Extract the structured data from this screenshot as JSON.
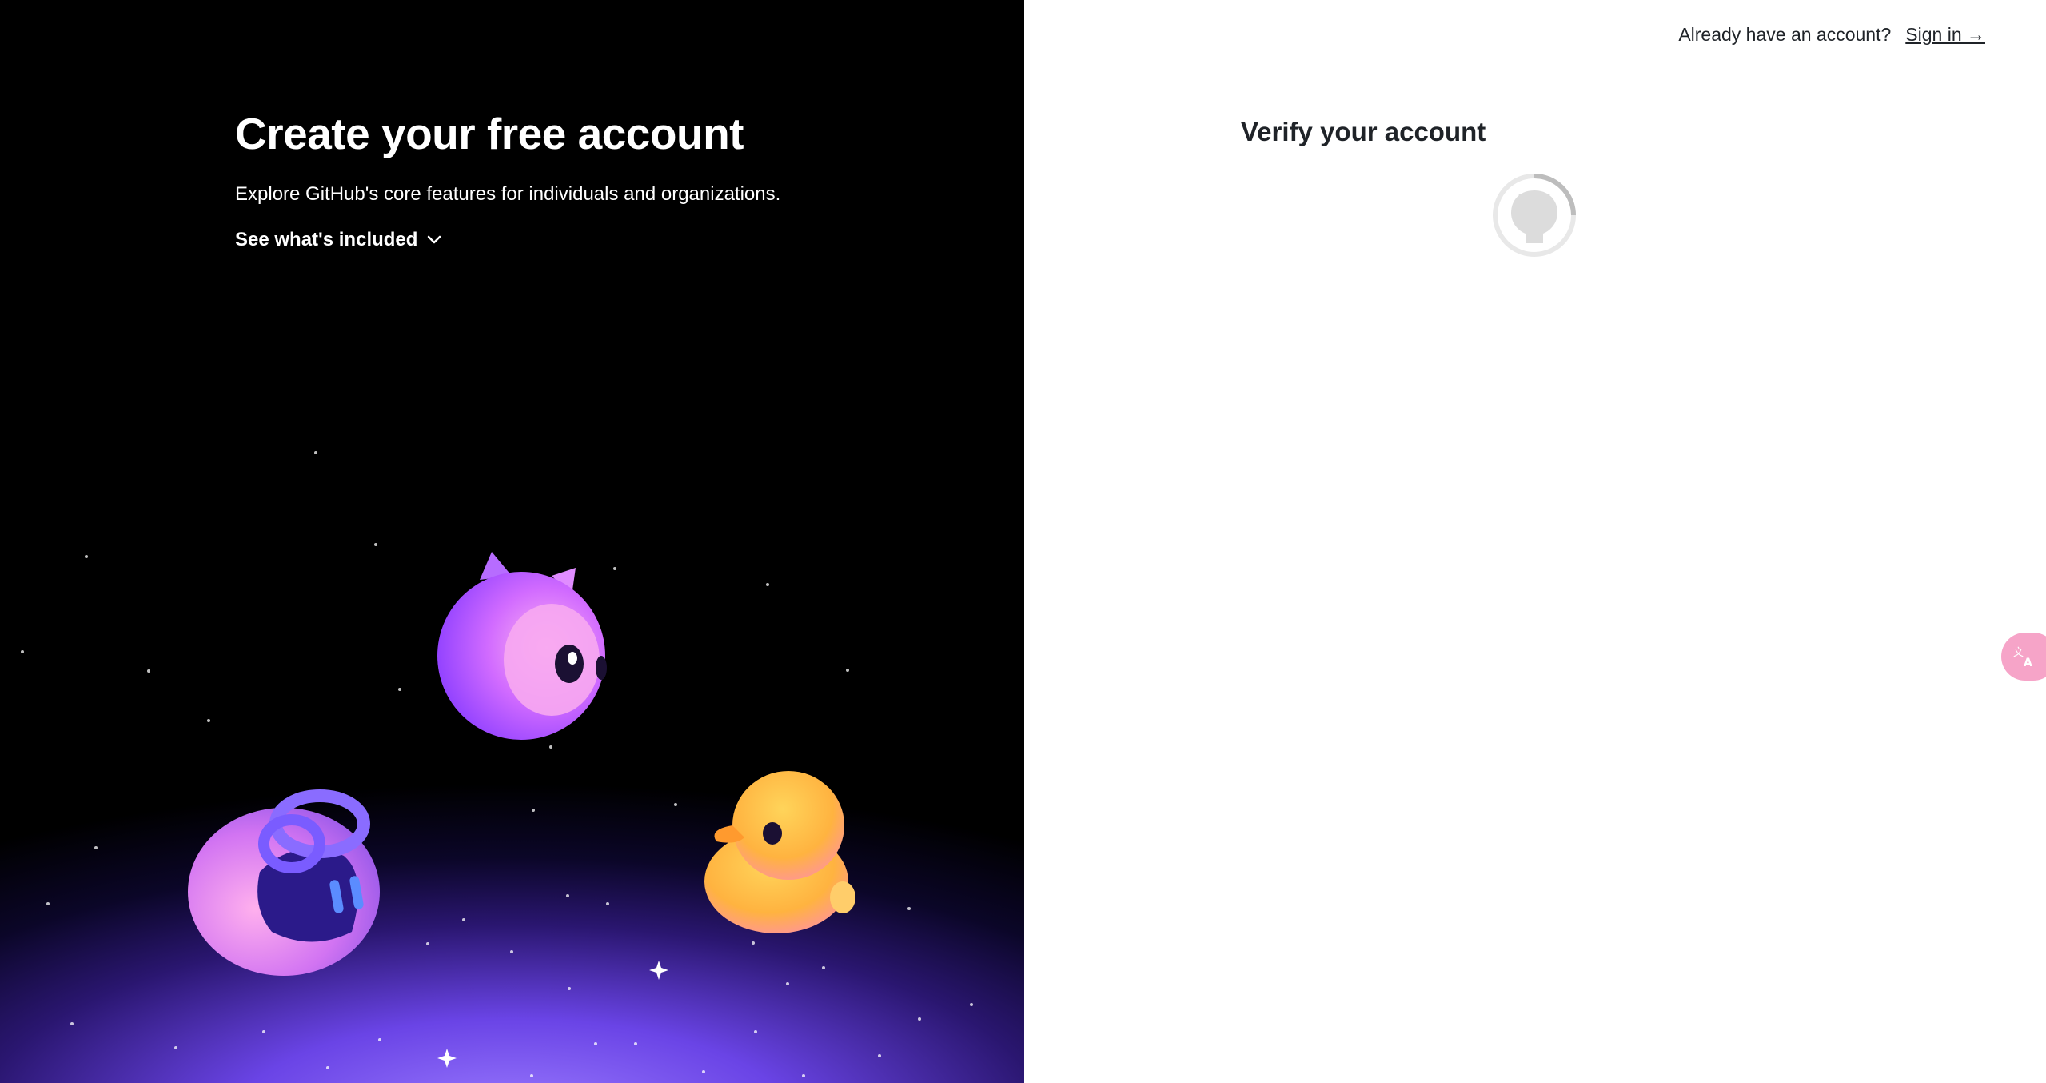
{
  "left": {
    "title": "Create your free account",
    "subtitle": "Explore GitHub's core features for individuals and organizations.",
    "toggle_label": "See what's included",
    "mascots": [
      "octocat-mascot",
      "copilot-robot-mascot",
      "rubber-duck-mascot"
    ]
  },
  "header": {
    "prompt": "Already have an account?",
    "signin_label": "Sign in →"
  },
  "main": {
    "title": "Verify your account",
    "loader_icon": "github-octocat-loading-icon"
  },
  "translate_button": {
    "icon": "translate-icon"
  },
  "colors": {
    "left_bg": "#000000",
    "glow": "#7c5cff",
    "text_dark": "#1f2328",
    "loader": "#d0d0d0",
    "fab": "#f6a4c8"
  }
}
